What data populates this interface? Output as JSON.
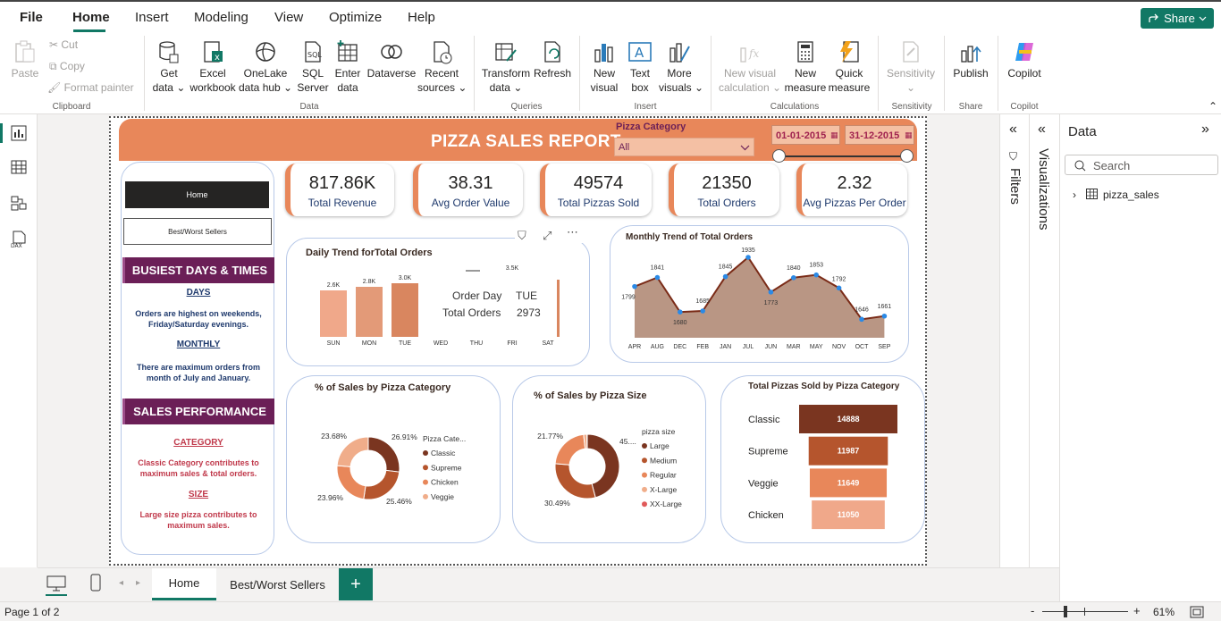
{
  "menu": {
    "file": "File",
    "home": "Home",
    "insert": "Insert",
    "modeling": "Modeling",
    "view": "View",
    "optimize": "Optimize",
    "help": "Help",
    "share": "Share"
  },
  "ribbon": {
    "paste": "Paste",
    "cut": "Cut",
    "copy": "Copy",
    "format_painter": "Format painter",
    "get_data": [
      "Get",
      "data"
    ],
    "excel": [
      "Excel",
      "workbook"
    ],
    "onelake": [
      "OneLake",
      "data hub"
    ],
    "sql": [
      "SQL",
      "Server"
    ],
    "enter_data": [
      "Enter",
      "data"
    ],
    "dataverse": "Dataverse",
    "recent": [
      "Recent",
      "sources"
    ],
    "transform": [
      "Transform",
      "data"
    ],
    "refresh": "Refresh",
    "new_visual": [
      "New",
      "visual"
    ],
    "text_box": [
      "Text",
      "box"
    ],
    "more_visuals": [
      "More",
      "visuals"
    ],
    "new_visual_calc": [
      "New visual",
      "calculation"
    ],
    "new_measure": [
      "New",
      "measure"
    ],
    "quick_measure": [
      "Quick",
      "measure"
    ],
    "sensitivity": "Sensitivity",
    "publish": "Publish",
    "copilot": "Copilot",
    "groups": {
      "clipboard": "Clipboard",
      "data": "Data",
      "queries": "Queries",
      "insert": "Insert",
      "calculations": "Calculations",
      "sensitivity": "Sensitivity",
      "share": "Share",
      "copilot": "Copilot"
    }
  },
  "report": {
    "title": "PIZZA SALES REPORT",
    "slicer_label": "Pizza Category",
    "slicer_value": "All",
    "date_start": "01-01-2015",
    "date_end": "31-12-2015",
    "nav_home": "Home",
    "nav_bws": "Best/Worst Sellers",
    "busiest_heading": "BUSIEST DAYS & TIMES",
    "days_label": "DAYS",
    "days_text": "Orders are highest on weekends, Friday/Saturday evenings.",
    "monthly_label": "MONTHLY",
    "monthly_text": "There are maximum orders from month of July and January.",
    "sales_heading": "SALES PERFORMANCE",
    "category_label": "CATEGORY",
    "category_text": "Classic Category contributes to maximum sales & total orders.",
    "size_label": "SIZE",
    "size_text": "Large size pizza contributes to maximum sales.",
    "kpis": [
      {
        "value": "817.86K",
        "label": "Total Revenue"
      },
      {
        "value": "38.31",
        "label": "Avg Order Value"
      },
      {
        "value": "49574",
        "label": "Total Pizzas Sold"
      },
      {
        "value": "21350",
        "label": "Total Orders"
      },
      {
        "value": "2.32",
        "label": "Avg Pizzas Per Order"
      }
    ],
    "tooltip": {
      "k1": "Order Day",
      "v1": "TUE",
      "k2": "Total Orders",
      "v2": "2973"
    }
  },
  "colors": {
    "brand": "#e8875a",
    "purple": "#6b1f57",
    "dark_brown": "#7a3520",
    "green": "#117865"
  },
  "chart_data": [
    {
      "type": "bar",
      "title": "Daily Trend forTotal Orders",
      "categories": [
        "SUN",
        "MON",
        "TUE",
        "WED",
        "THU",
        "FRI",
        "SAT"
      ],
      "values": [
        2600,
        2800,
        3000,
        2900,
        3200,
        3500,
        3200
      ],
      "data_labels": [
        "2.6K",
        "2.8K",
        "3.0K",
        "",
        "",
        "3.5K",
        ""
      ]
    },
    {
      "type": "area",
      "title": "Monthly Trend of Total Orders",
      "categories": [
        "APR",
        "AUG",
        "DEC",
        "FEB",
        "JAN",
        "JUL",
        "JUN",
        "MAR",
        "MAY",
        "NOV",
        "OCT",
        "SEP"
      ],
      "values": [
        1799,
        1841,
        1680,
        1685,
        1845,
        1935,
        1773,
        1840,
        1853,
        1792,
        1646,
        1661
      ]
    },
    {
      "type": "pie",
      "title": "% of Sales by Pizza Category",
      "legend_title": "Pizza Cate...",
      "categories": [
        "Classic",
        "Supreme",
        "Chicken",
        "Veggie"
      ],
      "values": [
        26.91,
        25.46,
        23.96,
        23.68
      ],
      "labels": [
        "26.91%",
        "25.46%",
        "23.96%",
        "23.68%"
      ],
      "colors": [
        "#7a3520",
        "#b5552d",
        "#e8875a",
        "#f0ad8a"
      ]
    },
    {
      "type": "pie",
      "title": "% of Sales by Pizza Size",
      "legend_title": "pizza size",
      "categories": [
        "Large",
        "Medium",
        "Regular",
        "X-Large",
        "XX-Large"
      ],
      "values": [
        45.89,
        30.49,
        21.77,
        1.72,
        0.12
      ],
      "labels": [
        "45....",
        "30.49%",
        "21.77%",
        "",
        ""
      ],
      "colors": [
        "#7a3520",
        "#b5552d",
        "#e8875a",
        "#f0ad8a",
        "#e05a5a"
      ]
    },
    {
      "type": "bar",
      "title": "Total Pizzas Sold by Pizza Category",
      "categories": [
        "Classic",
        "Supreme",
        "Veggie",
        "Chicken"
      ],
      "values": [
        14888,
        11987,
        11649,
        11050
      ],
      "colors": [
        "#7a3520",
        "#b5552d",
        "#e8875a",
        "#f0a88a"
      ]
    }
  ],
  "panes": {
    "filters": "Filters",
    "visualizations": "Visualizations",
    "data": "Data",
    "search": "Search",
    "table": "pizza_sales"
  },
  "tabs": {
    "home": "Home",
    "bws": "Best/Worst Sellers",
    "add": "+"
  },
  "status": {
    "page": "Page 1 of 2",
    "zoom": "61%",
    "zoom_minus": "-",
    "zoom_plus": "+"
  }
}
